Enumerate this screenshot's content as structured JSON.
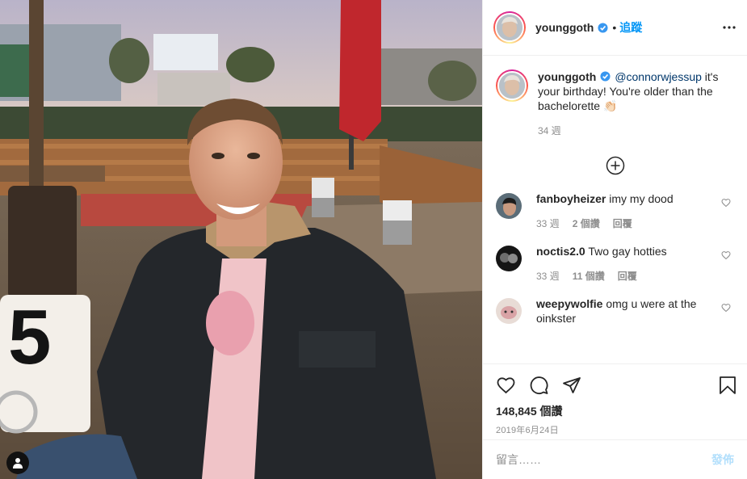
{
  "post": {
    "username": "younggoth",
    "follow_label": "追蹤",
    "caption_mention": "@connorwjessup",
    "caption_text": " it's your birthday! You're older than the bachelorette 👏🏻",
    "caption_age": "34 週",
    "likes": "148,845 個讚",
    "date": "2019年6月24日",
    "comment_placeholder": "留言……",
    "post_label": "發佈",
    "table_number": "5"
  },
  "comments": [
    {
      "username": "fanboyheizer",
      "text": "imy my dood",
      "age": "33 週",
      "likes": "2 個讚",
      "reply": "回覆"
    },
    {
      "username": "noctis2.0",
      "text": "Two gay hotties",
      "age": "33 週",
      "likes": "11 個讚",
      "reply": "回覆"
    },
    {
      "username": "weepywolfie",
      "text": "omg u were at the oinkster"
    }
  ],
  "icons": {
    "verified": "verified-badge-icon",
    "more": "more-options-icon",
    "load_more": "plus-circle-icon",
    "like": "heart-icon",
    "comment": "comment-icon",
    "share": "share-icon",
    "save": "bookmark-icon",
    "tag": "user-tag-icon"
  },
  "colors": {
    "accent": "#0095f6",
    "mention": "#00376b",
    "muted": "#8e8e8e",
    "post_disabled": "#b2dffc"
  }
}
